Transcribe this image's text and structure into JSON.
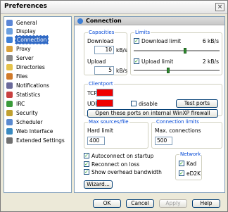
{
  "window": {
    "title": "Preferences",
    "close_glyph": "×"
  },
  "sidebar": {
    "items": [
      {
        "label": "General",
        "icon": "general-icon",
        "color": "#5a86d6"
      },
      {
        "label": "Display",
        "icon": "display-icon",
        "color": "#6aa0e0"
      },
      {
        "label": "Connection",
        "icon": "connection-icon",
        "color": "#3d7fd6"
      },
      {
        "label": "Proxy",
        "icon": "proxy-icon",
        "color": "#d9a23a"
      },
      {
        "label": "Server",
        "icon": "server-icon",
        "color": "#888888"
      },
      {
        "label": "Directories",
        "icon": "folder-icon",
        "color": "#e4c24a"
      },
      {
        "label": "Files",
        "icon": "files-icon",
        "color": "#d07a2a"
      },
      {
        "label": "Notifications",
        "icon": "notifications-icon",
        "color": "#6a6a9a"
      },
      {
        "label": "Statistics",
        "icon": "statistics-icon",
        "color": "#c84040"
      },
      {
        "label": "IRC",
        "icon": "irc-icon",
        "color": "#3a9a3a"
      },
      {
        "label": "Security",
        "icon": "security-icon",
        "color": "#c0a030"
      },
      {
        "label": "Scheduler",
        "icon": "scheduler-icon",
        "color": "#5a8ad0"
      },
      {
        "label": "Web Interface",
        "icon": "web-interface-icon",
        "color": "#3a8ac0"
      },
      {
        "label": "Extended Settings",
        "icon": "extended-settings-icon",
        "color": "#707070"
      }
    ]
  },
  "panel": {
    "title": "Connection",
    "capacities": {
      "title": "Capacities",
      "download_label": "Download",
      "download_value": "10",
      "upload_label": "Upload",
      "upload_value": "5",
      "unit": "kB/s"
    },
    "limits": {
      "title": "Limits",
      "download_label": "Download limit",
      "download_value": "6 kB/s",
      "download_level": 0.6,
      "upload_label": "Upload limit",
      "upload_value": "2 kB/s",
      "upload_level": 0.4,
      "check_mark": "✓"
    },
    "clientport": {
      "title": "Clientport",
      "tcp_label": "TCP",
      "udp_label": "UDP",
      "disable_label": "disable",
      "test_button": "Test ports",
      "firewall_button": "Open these ports on internal WinXP firewall"
    },
    "max_sources": {
      "title": "Max sources/file",
      "hard_limit_label": "Hard limit",
      "hard_limit_value": "400"
    },
    "connection_limits": {
      "title": "Connection limits",
      "max_label": "Max. connections",
      "max_value": "500"
    },
    "options": {
      "autoconnect": "Autoconnect on startup",
      "reconnect": "Reconnect on loss",
      "overhead": "Show overhead bandwidth"
    },
    "network": {
      "title": "Network",
      "kad": "Kad",
      "ed2k": "eD2K"
    },
    "wizard_button": "Wizard..."
  },
  "footer": {
    "ok": "OK",
    "cancel": "Cancel",
    "apply": "Apply",
    "help": "Help"
  }
}
